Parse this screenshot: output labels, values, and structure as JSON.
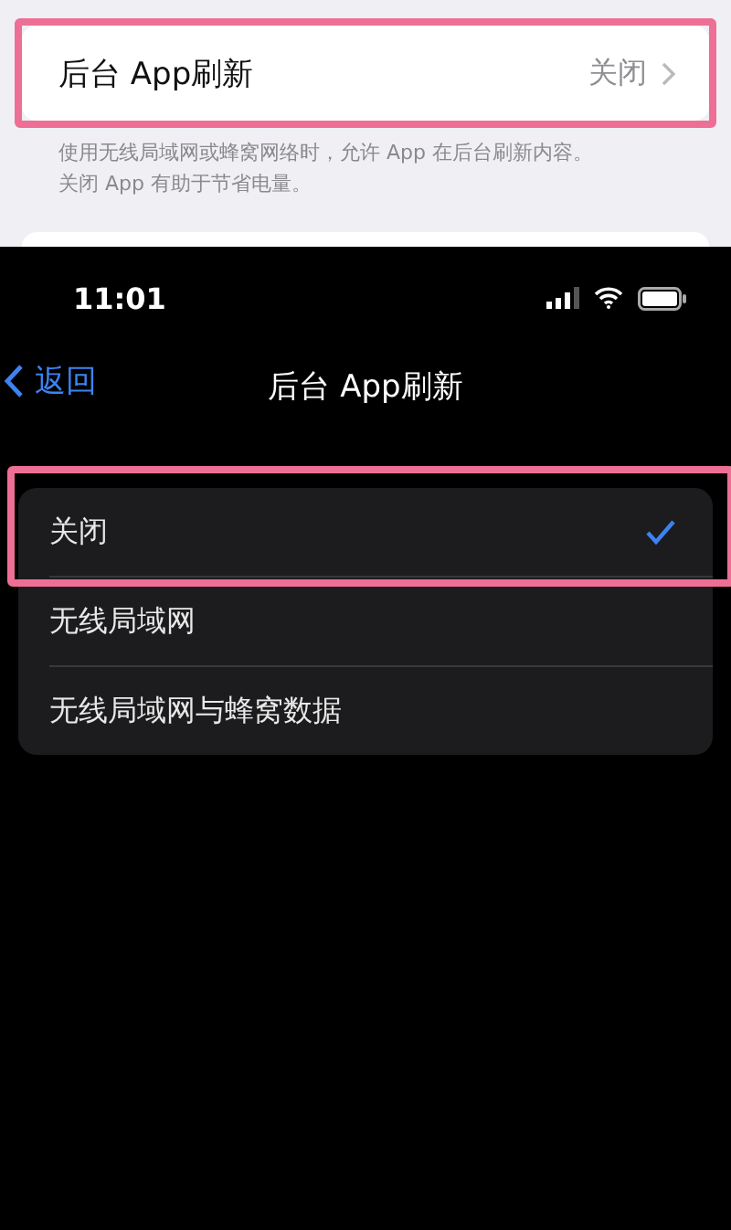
{
  "settings_row": {
    "label": "后台 App刷新",
    "value": "关闭",
    "highlighted": true
  },
  "description": [
    "使用无线局域网或蜂窝网络时，允许 App 在后台刷新内容。",
    "关闭 App 有助于节省电量。"
  ],
  "status_bar": {
    "time": "11:01"
  },
  "nav": {
    "back": "返回",
    "title": "后台 App刷新"
  },
  "options": [
    {
      "label": "关闭",
      "selected": true,
      "highlighted": true
    },
    {
      "label": "无线局域网",
      "selected": false,
      "highlighted": false
    },
    {
      "label": "无线局域网与蜂窝数据",
      "selected": false,
      "highlighted": false
    }
  ]
}
